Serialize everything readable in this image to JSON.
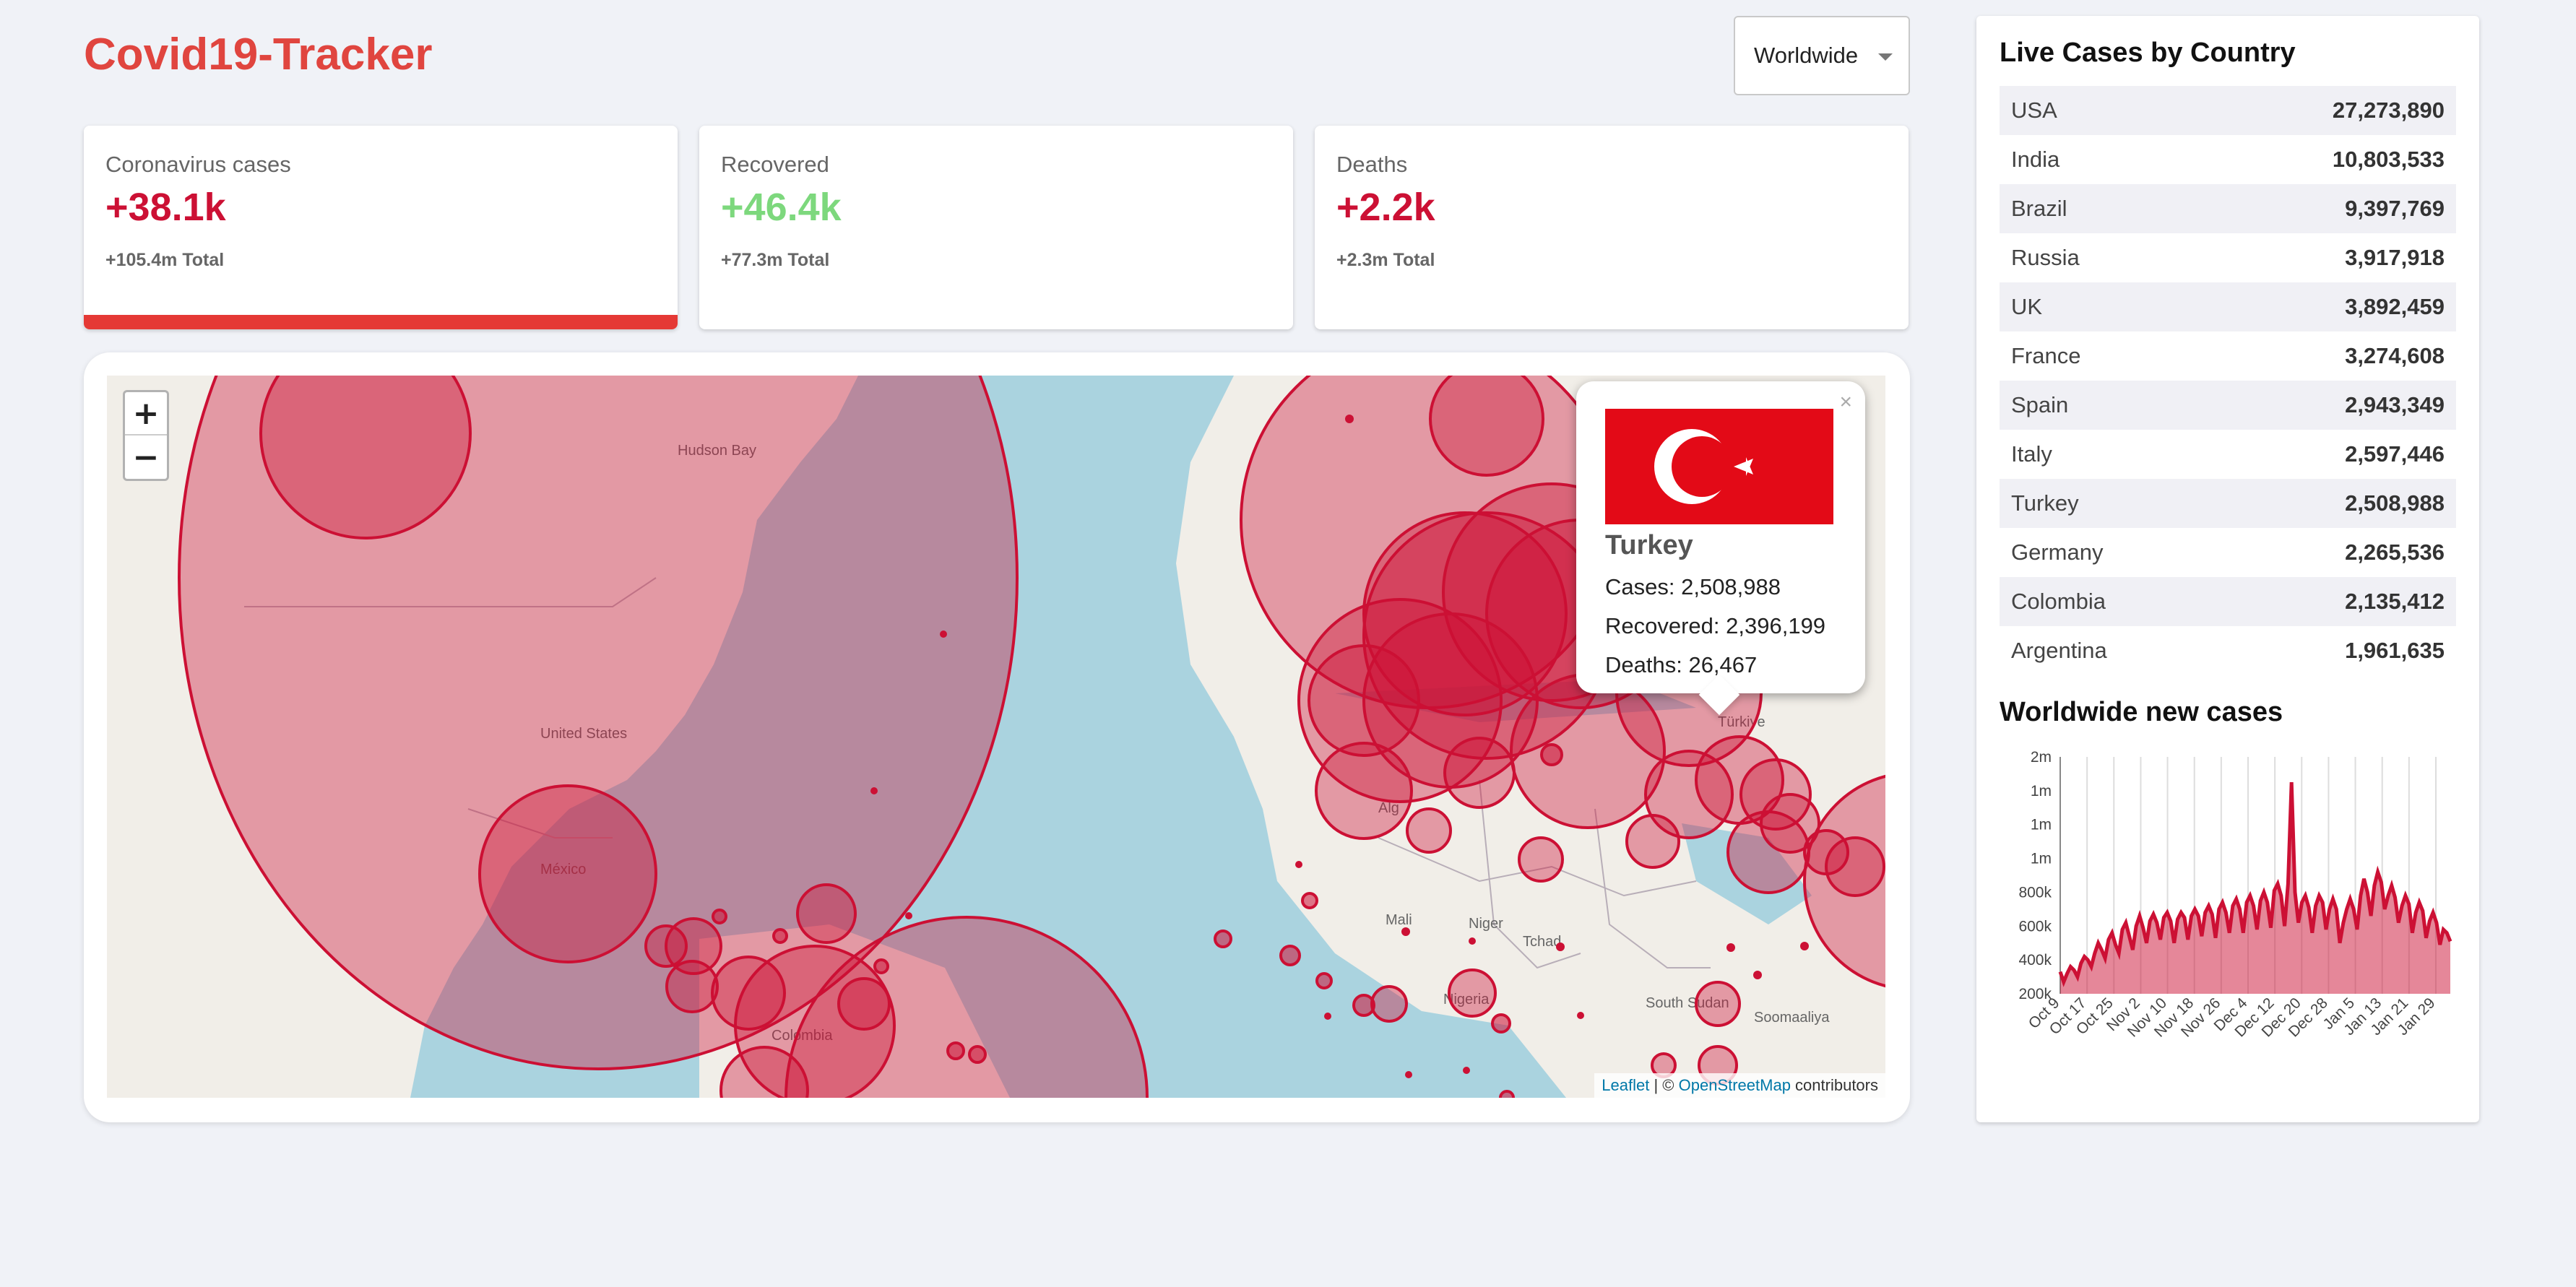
{
  "header": {
    "title": "Covid19-Tracker"
  },
  "country_select": {
    "value": "Worldwide"
  },
  "cards": [
    {
      "label": "Coronavirus cases",
      "value": "+38.1k",
      "total": "+105.4m Total",
      "color": "#cc1034"
    },
    {
      "label": "Recovered",
      "value": "+46.4k",
      "total": "+77.3m Total",
      "color": "#7dd87d"
    },
    {
      "label": "Deaths",
      "value": "+2.2k",
      "total": "+2.3m Total",
      "color": "#cc1034"
    }
  ],
  "map": {
    "zoom_in": "+",
    "zoom_out": "−",
    "labels": {
      "usa": "United States",
      "mexico": "México",
      "colombia": "Colombia",
      "hudson": "Hudson Bay",
      "mali": "Mali",
      "niger": "Niger",
      "tchad": "Tchad",
      "nigeria": "Nigeria",
      "south_sudan": "South Sudan",
      "somalia": "Soomaaliya",
      "turkiye": "Türkiye",
      "algeria": "Alg"
    },
    "attribution": {
      "leaflet": "Leaflet",
      "separator": " | © ",
      "osm": "OpenStreetMap",
      "suffix": " contributors"
    },
    "popup": {
      "country": "Turkey",
      "cases": "Cases: 2,508,988",
      "recovered": "Recovered: 2,396,199",
      "deaths": "Deaths: 26,467",
      "close": "×"
    }
  },
  "sidebar": {
    "table_title": "Live Cases by Country",
    "countries": [
      {
        "country": "USA",
        "cases": "27,273,890"
      },
      {
        "country": "India",
        "cases": "10,803,533"
      },
      {
        "country": "Brazil",
        "cases": "9,397,769"
      },
      {
        "country": "Russia",
        "cases": "3,917,918"
      },
      {
        "country": "UK",
        "cases": "3,892,459"
      },
      {
        "country": "France",
        "cases": "3,274,608"
      },
      {
        "country": "Spain",
        "cases": "2,943,349"
      },
      {
        "country": "Italy",
        "cases": "2,597,446"
      },
      {
        "country": "Turkey",
        "cases": "2,508,988"
      },
      {
        "country": "Germany",
        "cases": "2,265,536"
      },
      {
        "country": "Colombia",
        "cases": "2,135,412"
      },
      {
        "country": "Argentina",
        "cases": "1,961,635"
      }
    ],
    "chart_title": "Worldwide new cases"
  },
  "chart_data": {
    "type": "area",
    "title": "Worldwide new cases",
    "color": "#cc1034",
    "yticks": [
      "2m",
      "1m",
      "1m",
      "1m",
      "800k",
      "600k",
      "400k",
      "200k"
    ],
    "ytick_values": [
      1800000,
      1600000,
      1400000,
      1200000,
      1000000,
      800000,
      600000,
      400000
    ],
    "ylim": [
      400000,
      1800000
    ],
    "xticks": [
      "Oct 9",
      "Oct 17",
      "Oct 25",
      "Nov 2",
      "Nov 10",
      "Nov 18",
      "Nov 26",
      "Dec 4",
      "Dec 12",
      "Dec 20",
      "Dec 28",
      "Jan 5",
      "Jan 13",
      "Jan 21",
      "Jan 29"
    ],
    "grid": "vertical",
    "values": [
      530000,
      470000,
      520000,
      560000,
      540000,
      500000,
      580000,
      620000,
      600000,
      560000,
      640000,
      700000,
      660000,
      610000,
      720000,
      760000,
      690000,
      640000,
      780000,
      820000,
      740000,
      660000,
      800000,
      860000,
      790000,
      700000,
      830000,
      870000,
      820000,
      720000,
      850000,
      880000,
      830000,
      700000,
      840000,
      880000,
      850000,
      720000,
      860000,
      900000,
      860000,
      740000,
      880000,
      920000,
      870000,
      730000,
      900000,
      940000,
      880000,
      760000,
      920000,
      960000,
      900000,
      760000,
      940000,
      980000,
      920000,
      780000,
      950000,
      1000000,
      940000,
      790000,
      1010000,
      1050000,
      980000,
      800000,
      1050000,
      1650000,
      1000000,
      820000,
      940000,
      980000,
      910000,
      760000,
      920000,
      980000,
      940000,
      780000,
      900000,
      960000,
      900000,
      700000,
      820000,
      900000,
      960000,
      900000,
      780000,
      980000,
      1080000,
      1000000,
      860000,
      1040000,
      1120000,
      1060000,
      900000,
      980000,
      1040000,
      970000,
      820000,
      920000,
      980000,
      930000,
      760000,
      880000,
      940000,
      890000,
      730000,
      830000,
      880000,
      820000,
      690000,
      780000,
      760000,
      710000
    ]
  }
}
